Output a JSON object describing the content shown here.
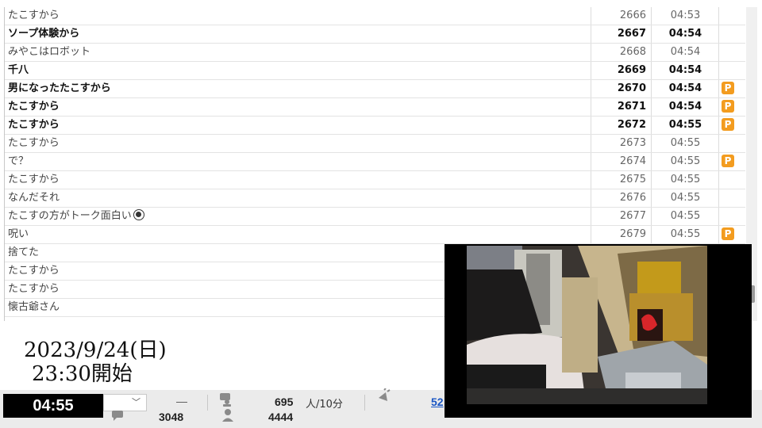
{
  "comments": [
    {
      "text": "たこすから",
      "number": "2666",
      "time": "04:53",
      "bold": false,
      "premium": false
    },
    {
      "text": "ソープ体験から",
      "number": "2667",
      "time": "04:54",
      "bold": true,
      "premium": false
    },
    {
      "text": "みやこはロボット",
      "number": "2668",
      "time": "04:54",
      "bold": false,
      "premium": false
    },
    {
      "text": "千八",
      "number": "2669",
      "time": "04:54",
      "bold": true,
      "premium": false
    },
    {
      "text": "男になったたこすから",
      "number": "2670",
      "time": "04:54",
      "bold": true,
      "premium": true
    },
    {
      "text": "たこすから",
      "number": "2671",
      "time": "04:54",
      "bold": true,
      "premium": true
    },
    {
      "text": "たこすから",
      "number": "2672",
      "time": "04:55",
      "bold": true,
      "premium": true
    },
    {
      "text": "たこすから",
      "number": "2673",
      "time": "04:55",
      "bold": false,
      "premium": false
    },
    {
      "text": "で？",
      "number": "2674",
      "time": "04:55",
      "bold": false,
      "premium": true
    },
    {
      "text": "たこすから",
      "number": "2675",
      "time": "04:55",
      "bold": false,
      "premium": false
    },
    {
      "text": "なんだそれ",
      "number": "2676",
      "time": "04:55",
      "bold": false,
      "premium": false
    },
    {
      "text": "たこすの方がトーク面白い",
      "number": "2677",
      "time": "04:55",
      "bold": false,
      "premium": false,
      "emoji": "smile-icon"
    },
    {
      "text": "呪い",
      "number": "2679",
      "time": "04:55",
      "bold": false,
      "premium": true
    },
    {
      "text": "捨てた",
      "number": "",
      "time": "",
      "bold": false,
      "premium": false
    },
    {
      "text": "たこすから",
      "number": "",
      "time": "",
      "bold": false,
      "premium": false
    },
    {
      "text": "たこすから",
      "number": "",
      "time": "",
      "bold": false,
      "premium": false
    },
    {
      "text": "懐古爺さん",
      "number": "",
      "time": "",
      "bold": false,
      "premium": false
    }
  ],
  "premium_badge": "P",
  "overlay": {
    "date": "2023/9/24(日)",
    "start": "23:30開始"
  },
  "status": {
    "clock": "04:55",
    "dash": "—",
    "comments_total": "3048",
    "viewers_rate": "695",
    "viewers_rate_unit": "人/10分",
    "visitors": "4444",
    "link_partial": "52"
  },
  "colors": {
    "premium": "#f39c1f",
    "clock_bg": "#000000",
    "link": "#1a56c4"
  }
}
